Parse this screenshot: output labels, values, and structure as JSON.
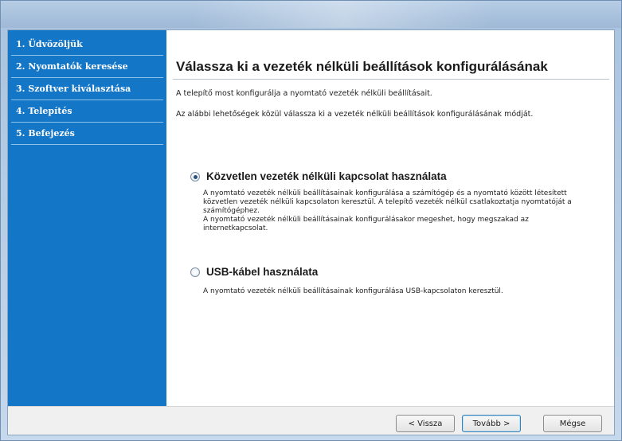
{
  "sidebar": {
    "items": [
      {
        "label": "1. Üdvözöljük"
      },
      {
        "label": "2. Nyomtatók keresése"
      },
      {
        "label": "3. Szoftver kiválasztása"
      },
      {
        "label": "4. Telepítés"
      },
      {
        "label": "5. Befejezés"
      }
    ]
  },
  "main": {
    "heading": "Válassza ki a vezeték nélküli beállítások konfigurálásának",
    "intro1": "A telepítő most konfigurálja a nyomtató vezeték nélküli beállításait.",
    "intro2": "Az alábbi lehetőségek közül válassza ki a vezeték nélküli beállítások konfigurálásának módját.",
    "options": [
      {
        "label": "Közvetlen vezeték nélküli kapcsolat használata",
        "checked": true,
        "desc_lines": [
          "A nyomtató vezeték nélküli beállításainak konfigurálása a számítógép és a nyomtató között létesített",
          "közvetlen vezeték nélküli kapcsolaton keresztül. A telepítő vezeték nélkül csatlakoztatja nyomtatóját a",
          "számítógéphez.",
          "A nyomtató vezeték nélküli beállításainak konfigurálásakor megeshet, hogy megszakad az",
          "internetkapcsolat."
        ]
      },
      {
        "label": "USB-kábel használata",
        "checked": false,
        "desc_lines": [
          "A nyomtató vezeték nélküli beállításainak konfigurálása USB-kapcsolaton keresztül."
        ]
      }
    ]
  },
  "footer": {
    "back": "< Vissza",
    "next": "Tovább >",
    "cancel": "Mégse"
  }
}
